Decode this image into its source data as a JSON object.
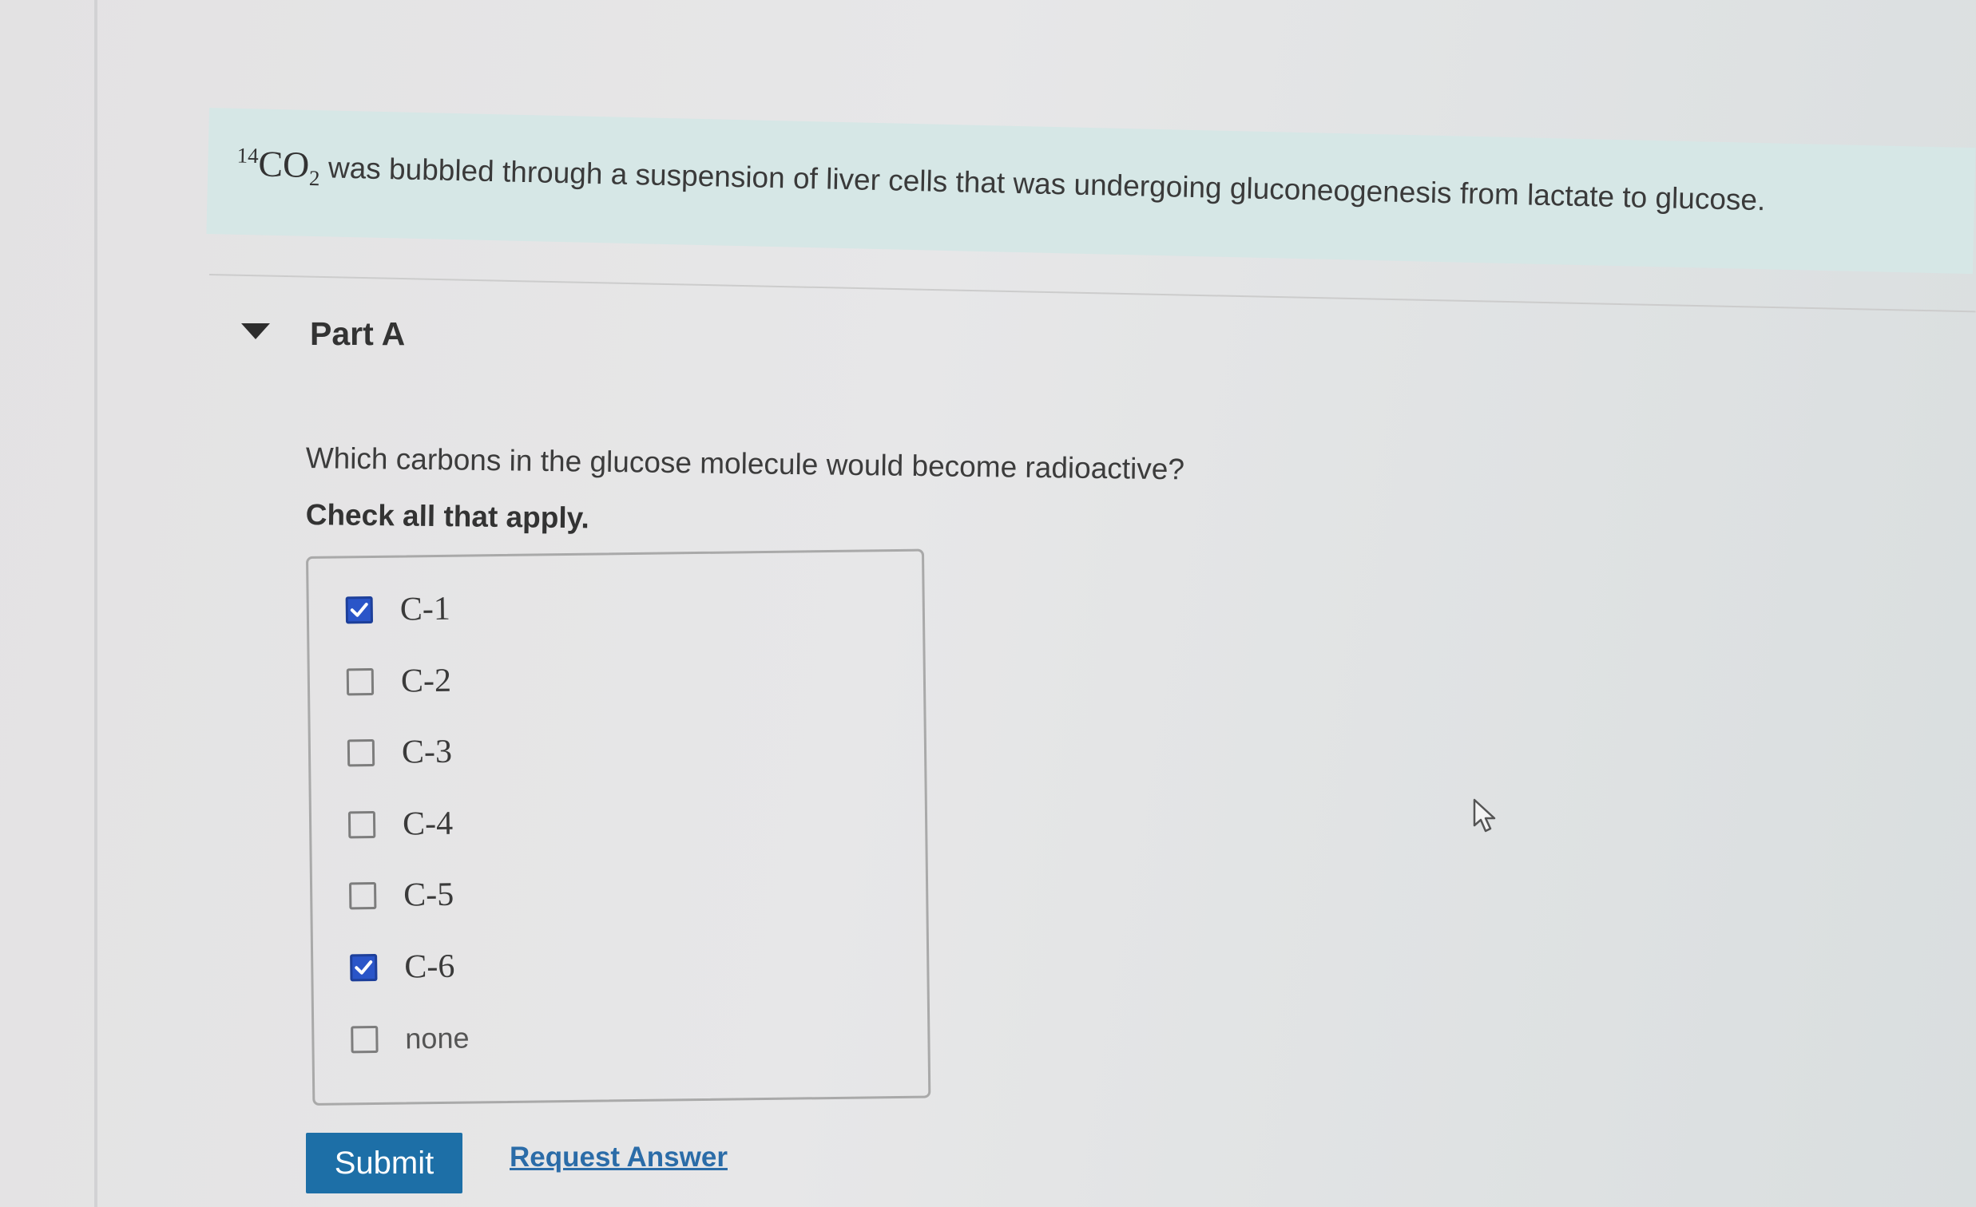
{
  "intro": {
    "formula_sup": "14",
    "formula_main": "CO",
    "formula_sub": "2",
    "text": "was bubbled through a suspension of liver cells that was undergoing gluconeogenesis from lactate to glucose."
  },
  "part": {
    "title": "Part A",
    "question": "Which carbons in the glucose molecule would become radioactive?",
    "instruction": "Check all that apply."
  },
  "options": [
    {
      "label": "C-1",
      "checked": true
    },
    {
      "label": "C-2",
      "checked": false
    },
    {
      "label": "C-3",
      "checked": false
    },
    {
      "label": "C-4",
      "checked": false
    },
    {
      "label": "C-5",
      "checked": false
    },
    {
      "label": "C-6",
      "checked": true
    },
    {
      "label": "none",
      "checked": false
    }
  ],
  "actions": {
    "submit_label": "Submit",
    "request_label": "Request Answer"
  },
  "colors": {
    "accent": "#1d6fa7",
    "checkbox_checked": "#2a55c8",
    "intro_bg": "#d6e7e6",
    "link": "#2b6ca8"
  }
}
